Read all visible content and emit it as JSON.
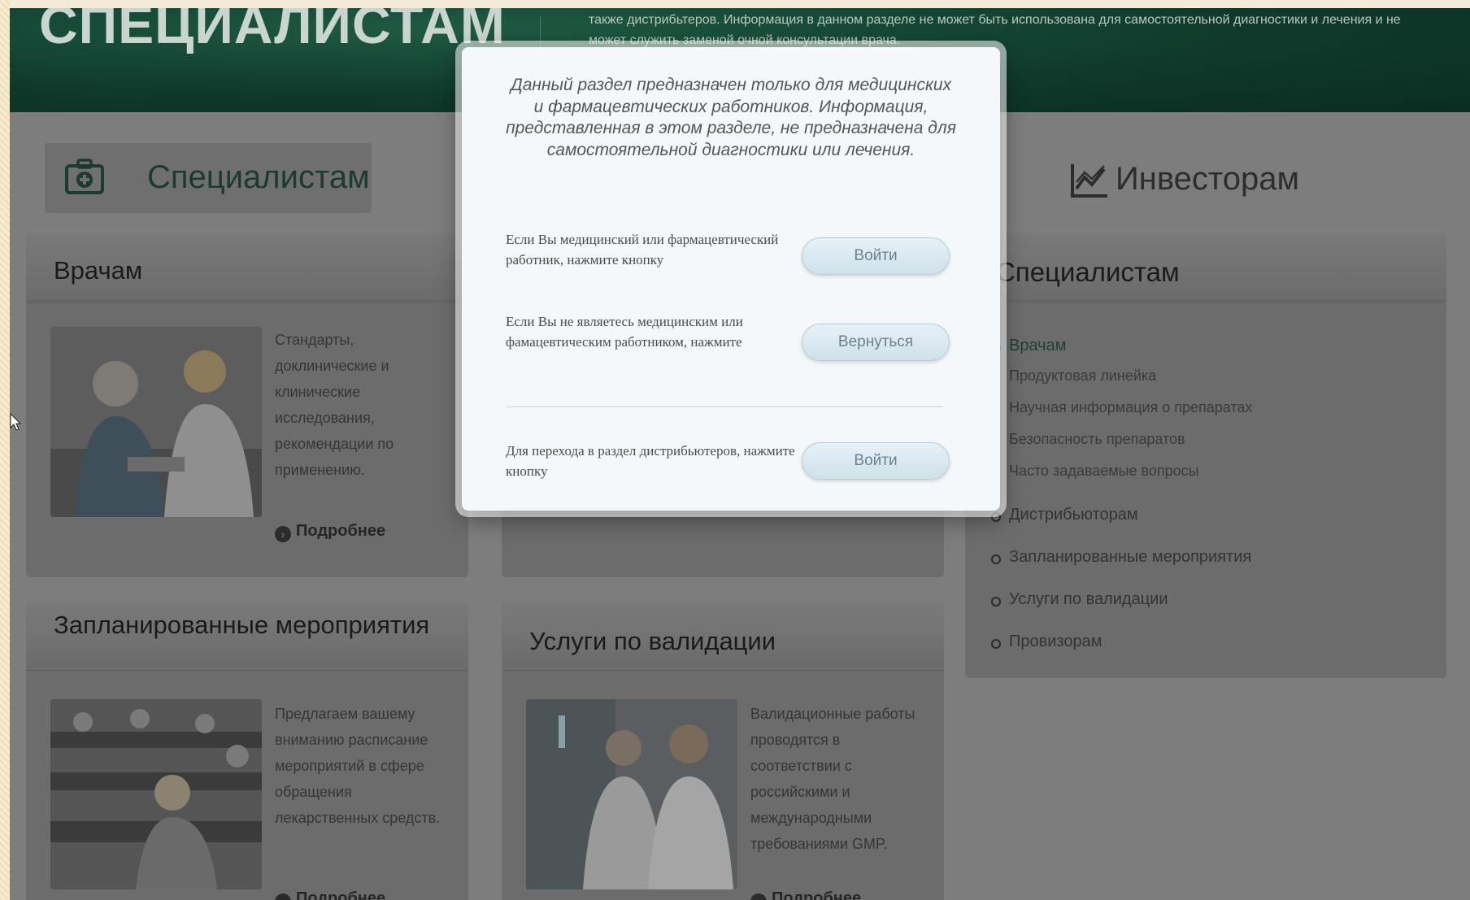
{
  "header": {
    "title": "СПЕЦИАЛИСТАМ",
    "note": "также дистрибьтеров. Информация в данном разделе не может быть использована для самостоятельной диагностики и лечения и не может служить заменой очной консультации врача."
  },
  "tabs": {
    "specialists": "Специалистам",
    "investors": "Инвесторам"
  },
  "cards": {
    "doctors": {
      "title": "Врачам",
      "text": "Стандарты, доклинические и клинические исследования, рекомендации по применению.",
      "more": "Подробнее"
    },
    "events": {
      "title": "Запланированные мероприятия",
      "text": "Предлагаем вашему вниманию расписание мероприятий в сфере обращения лекарственных средств.",
      "more": "Подробнее"
    },
    "validation": {
      "title": "Услуги по валидации",
      "text": "Валидационные работы проводятся в соответствии с российскими и международными требованиями GMP.",
      "more": "Подробнее"
    }
  },
  "sidebar": {
    "title": "Специалистам",
    "items": [
      {
        "label": "Врачам"
      },
      {
        "label": "Продуктовая линейка"
      },
      {
        "label": "Научная информация о препаратах"
      },
      {
        "label": "Безопасность препаратов"
      },
      {
        "label": "Часто задаваемые вопросы"
      },
      {
        "label": "Дистрибьюторам"
      },
      {
        "label": "Запланированные мероприятия"
      },
      {
        "label": "Услуги по валидации"
      },
      {
        "label": "Провизорам"
      }
    ]
  },
  "modal": {
    "notice": "Данный раздел предназначен только для медицинских и фармацевтических работников. Информация, представленная в этом разделе, не предназначена для самостоятельной диагностики или лечения.",
    "row1_text": "Если Вы медицинский или фармацевтический работник, нажмите кнопку",
    "row1_button": "Войти",
    "row2_text": "Если Вы не являетесь медицинским или фамацевтическим работником, нажмите",
    "row2_button": "Вернуться",
    "row3_text": "Для перехода в раздел дистрибьютеров, нажмите кнопку",
    "row3_button": "Войти"
  },
  "colors": {
    "header_green": "#0f3a2b",
    "button_bg": "#dbe9f0",
    "overlay_gray": "#7d7d7d"
  }
}
